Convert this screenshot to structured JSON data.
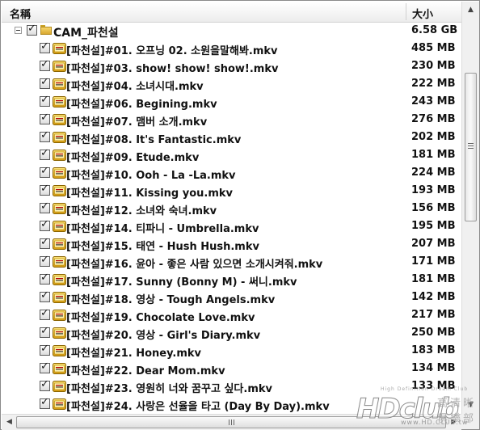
{
  "columns": {
    "name": "名稱",
    "size": "大小"
  },
  "folder": {
    "name": "CAM_파천설",
    "size": "6.58 GB",
    "checked": true,
    "expanded": true
  },
  "files": [
    {
      "name": "[파천설]#01. 오프닝 02. 소원을말해봐.mkv",
      "size": "485 MB"
    },
    {
      "name": "[파천설]#03. show! show! show!.mkv",
      "size": "230 MB"
    },
    {
      "name": "[파천설]#04. 소녀시대.mkv",
      "size": "222 MB"
    },
    {
      "name": "[파천설]#06. Begining.mkv",
      "size": "243 MB"
    },
    {
      "name": "[파천설]#07. 맴버 소개.mkv",
      "size": "276 MB"
    },
    {
      "name": "[파천설]#08. It's Fantastic.mkv",
      "size": "202 MB"
    },
    {
      "name": "[파천설]#09. Etude.mkv",
      "size": "181 MB"
    },
    {
      "name": "[파천설]#10. Ooh - La -La.mkv",
      "size": "224 MB"
    },
    {
      "name": "[파천설]#11. Kissing you.mkv",
      "size": "193 MB"
    },
    {
      "name": "[파천설]#12. 소녀와 숙녀.mkv",
      "size": "156 MB"
    },
    {
      "name": "[파천설]#14. 티파니 - Umbrella.mkv",
      "size": "195 MB"
    },
    {
      "name": "[파천설]#15. 태연 - Hush Hush.mkv",
      "size": "207 MB"
    },
    {
      "name": "[파천설]#16. 윤아 - 좋은 사람 있으면 소개시켜줘.mkv",
      "size": "171 MB"
    },
    {
      "name": "[파천설]#17. Sunny (Bonny M) - 써니.mkv",
      "size": "181 MB"
    },
    {
      "name": "[파천설]#18. 영상 - Tough Angels.mkv",
      "size": "142 MB"
    },
    {
      "name": "[파천설]#19. Chocolate Love.mkv",
      "size": "217 MB"
    },
    {
      "name": "[파천설]#20. 영상 - Girl's Diary.mkv",
      "size": "250 MB"
    },
    {
      "name": "[파천설]#21. Honey.mkv",
      "size": "183 MB"
    },
    {
      "name": "[파천설]#22. Dear Mom.mkv",
      "size": "134 MB"
    },
    {
      "name": "[파천설]#23. 영원히 너와 꿈꾸고 싶다.mkv",
      "size": "133 MB"
    },
    {
      "name": "[파천설]#24. 사랑은 선율을 타고 (Day By Day).mkv",
      "size": ""
    }
  ],
  "file_icon": "mkv-video-file-icon",
  "checkbox_state": "checked",
  "watermark": {
    "tagline": "High Definition Dream Club",
    "logo": "HDclub",
    "cn": "高清晰俱樂部",
    "url": "www.HD.CLUB.tw"
  },
  "colors": {
    "icon_gold": "#e8b820",
    "folder": "#f0c850",
    "check": "#1a1a1a"
  }
}
